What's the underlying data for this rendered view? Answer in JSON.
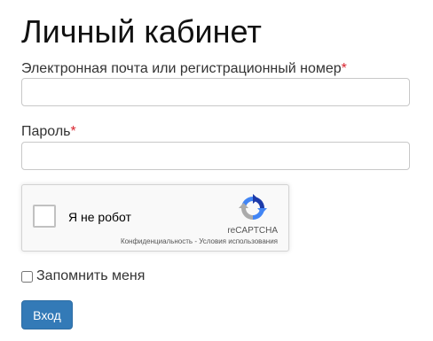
{
  "page": {
    "title": "Личный кабинет"
  },
  "form": {
    "email_label": "Электронная почта или регистрационный номер",
    "email_required_mark": "*",
    "email_value": "",
    "password_label": "Пароль",
    "password_required_mark": "*",
    "password_value": "",
    "remember_label": "Запомнить меня",
    "remember_checked": false,
    "submit_label": "Вход"
  },
  "recaptcha": {
    "checkbox_label": "Я не робот",
    "brand": "reCAPTCHA",
    "privacy_link": "Конфиденциальность",
    "separator": " - ",
    "terms_link": "Условия использования",
    "icon": "recaptcha-logo-icon"
  },
  "colors": {
    "required": "#d9232e",
    "button_bg": "#337ab7",
    "button_text": "#ffffff"
  }
}
